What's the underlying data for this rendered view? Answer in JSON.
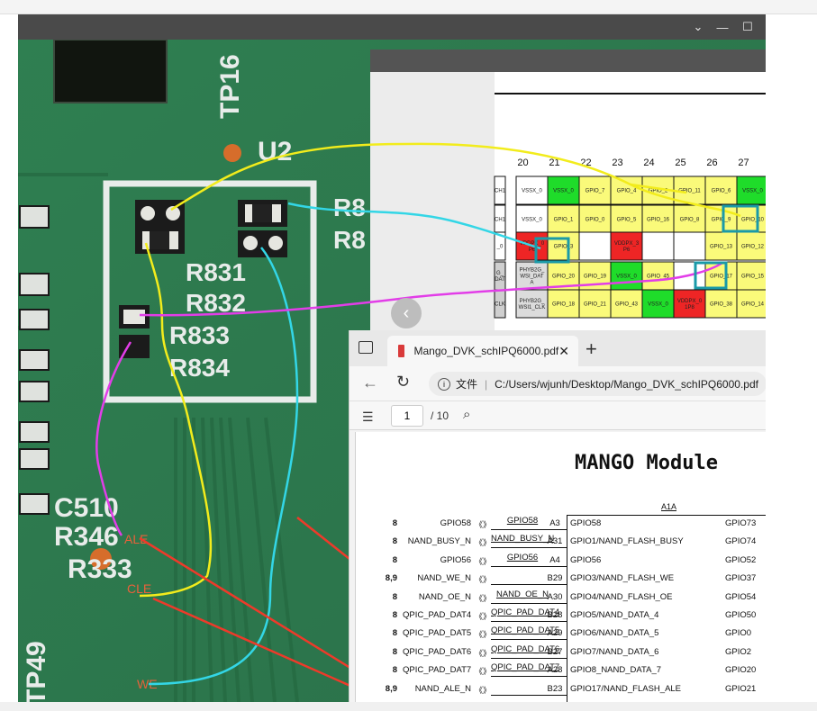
{
  "viewer": {
    "controls": [
      "⌄",
      "—",
      "☐"
    ]
  },
  "pcb": {
    "silk_labels": {
      "tp16": "TP16",
      "u2": "U2",
      "r8a": "R8",
      "r8b": "R8",
      "r831": "R831",
      "r832": "R832",
      "r833": "R833",
      "r834": "R834",
      "c510": "C510",
      "r346": "R346",
      "r333": "R333",
      "tp49": "TP49"
    },
    "annotations": {
      "ale": "ALE",
      "cle": "CLE",
      "we": "WE"
    },
    "colors": {
      "board": "#2d7a4e",
      "silk": "#e8ecea",
      "yellow_wire": "#f2ec1c",
      "cyan_wire": "#33d6e6",
      "magenta_wire": "#e23de8",
      "red_arrow": "#ee3a2a"
    }
  },
  "pinout": {
    "columns": [
      "20",
      "21",
      "22",
      "23",
      "24",
      "25",
      "26",
      "27"
    ],
    "rows": [
      [
        "CH1",
        "VSSX_0",
        "VSSX_0",
        "GPIO_7",
        "GPIO_4",
        "GPIO_2",
        "GPIO_11",
        "GPIO_6",
        "VSSX_0"
      ],
      [
        "CH1",
        "VSSX_0",
        "GPIO_1",
        "GPIO_0",
        "GPIO_5",
        "GPIO_16",
        "GPIO_8",
        "GPIO_9",
        "GPIO_10"
      ],
      [
        "_0",
        "VDDPX_0 P6",
        "GPIO_3",
        "",
        "VDDPX_3 P6",
        "",
        "",
        "GPIO_13",
        "GPIO_12"
      ],
      [
        "G_ DAT",
        "PHYB2G_ WSI_DAT A",
        "GPIO_20",
        "GPIO_19",
        "VSSX_0",
        "GPIO_45",
        "",
        "GPIO_17",
        "GPIO_15"
      ],
      [
        "CLK",
        "PHYB2G_ WSI1_CLK",
        "GPIO_18",
        "GPIO_21",
        "GPIO_43",
        "VSSX_0",
        "VDDPX_0 1P8",
        "GPIO_38",
        "GPIO_14"
      ]
    ]
  },
  "pdf": {
    "tab_title": "Mango_DVK_schIPQ6000.pdf",
    "address_prefix": "文件",
    "address_path": "C:/Users/wjunh/Desktop/Mango_DVK_schIPQ6000.pdf",
    "page_current": "1",
    "page_total": "/ 10",
    "module_title": "MANGO Module",
    "ref": "A1A",
    "signals": [
      {
        "sheet": "8",
        "name": "GPIO58",
        "net": "GPIO58",
        "ball": "A3",
        "func": "GPIO58",
        "right": "GPIO73"
      },
      {
        "sheet": "8",
        "name": "NAND_BUSY_N",
        "net": "NAND_BUSY_N",
        "ball": "A31",
        "func": "GPIO1/NAND_FLASH_BUSY",
        "right": "GPIO74"
      },
      {
        "sheet": "8",
        "name": "GPIO56",
        "net": "GPIO56",
        "ball": "A4",
        "func": "GPIO56",
        "right": "GPIO52"
      },
      {
        "sheet": "8,9",
        "name": "NAND_WE_N",
        "net": "",
        "ball": "B29",
        "func": "GPIO3/NAND_FLASH_WE",
        "right": "GPIO37"
      },
      {
        "sheet": "8",
        "name": "NAND_OE_N",
        "net": "NAND_OE_N",
        "ball": "A30",
        "func": "GPIO4/NAND_FLASH_OE",
        "right": "GPIO54"
      },
      {
        "sheet": "8",
        "name": "QPIC_PAD_DAT4",
        "net": "QPIC_PAD_DAT4",
        "ball": "B28",
        "func": "GPIO5/NAND_DATA_4",
        "right": "GPIO50"
      },
      {
        "sheet": "8",
        "name": "QPIC_PAD_DAT5",
        "net": "QPIC_PAD_DAT5",
        "ball": "A29",
        "func": "GPIO6/NAND_DATA_5",
        "right": "GPIO0"
      },
      {
        "sheet": "8",
        "name": "QPIC_PAD_DAT6",
        "net": "QPIC_PAD_DAT6",
        "ball": "B27",
        "func": "GPIO7/NAND_DATA_6",
        "right": "GPIO2"
      },
      {
        "sheet": "8",
        "name": "QPIC_PAD_DAT7",
        "net": "QPIC_PAD_DAT7",
        "ball": "A28",
        "func": "GPIO8_NAND_DATA_7",
        "right": "GPIO20"
      },
      {
        "sheet": "8,9",
        "name": "NAND_ALE_N",
        "net": "",
        "ball": "B23",
        "func": "GPIO17/NAND_FLASH_ALE",
        "right": "GPIO21"
      }
    ]
  }
}
